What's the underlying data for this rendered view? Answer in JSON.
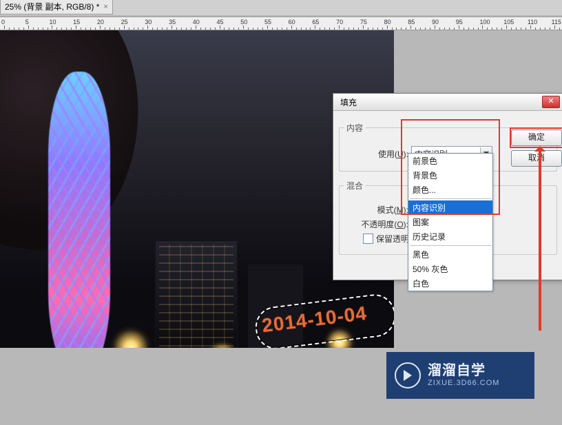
{
  "document_tab": {
    "title": "25% (背景 副本, RGB/8) *"
  },
  "ruler": {
    "ticks": [
      0,
      5,
      10,
      15,
      20,
      25,
      30,
      35,
      40,
      45,
      50,
      55,
      60,
      65,
      70,
      75,
      80,
      85,
      90,
      95,
      100,
      105,
      110,
      115
    ]
  },
  "image": {
    "date_stamp": "2014-10-04"
  },
  "dialog": {
    "title": "填充",
    "ok": "确定",
    "cancel": "取消",
    "close_glyph": "✕",
    "content_group": {
      "legend": "内容",
      "use_label_prefix": "使用(",
      "use_hotkey": "U",
      "use_label_suffix": "):",
      "use_value": "内容识别"
    },
    "blend_group": {
      "legend": "混合",
      "mode_label_prefix": "模式(",
      "mode_hotkey": "M",
      "mode_label_suffix": "):",
      "opacity_label_prefix": "不透明度(",
      "opacity_hotkey": "O",
      "opacity_label_suffix": "):",
      "preserve_trans_prefix": "保留透明区",
      "preserve_trans_hotkey": ""
    },
    "dropdown_state": "open",
    "dropdown_options_1": [
      "前景色",
      "背景色",
      "颜色..."
    ],
    "dropdown_selected": "内容识别",
    "dropdown_options_2": [
      "图案",
      "历史记录"
    ],
    "dropdown_options_3": [
      "黑色",
      "50% 灰色",
      "白色"
    ]
  },
  "watermark": {
    "line1": "溜溜自学",
    "line2": "ZIXUE.3D66.COM"
  }
}
